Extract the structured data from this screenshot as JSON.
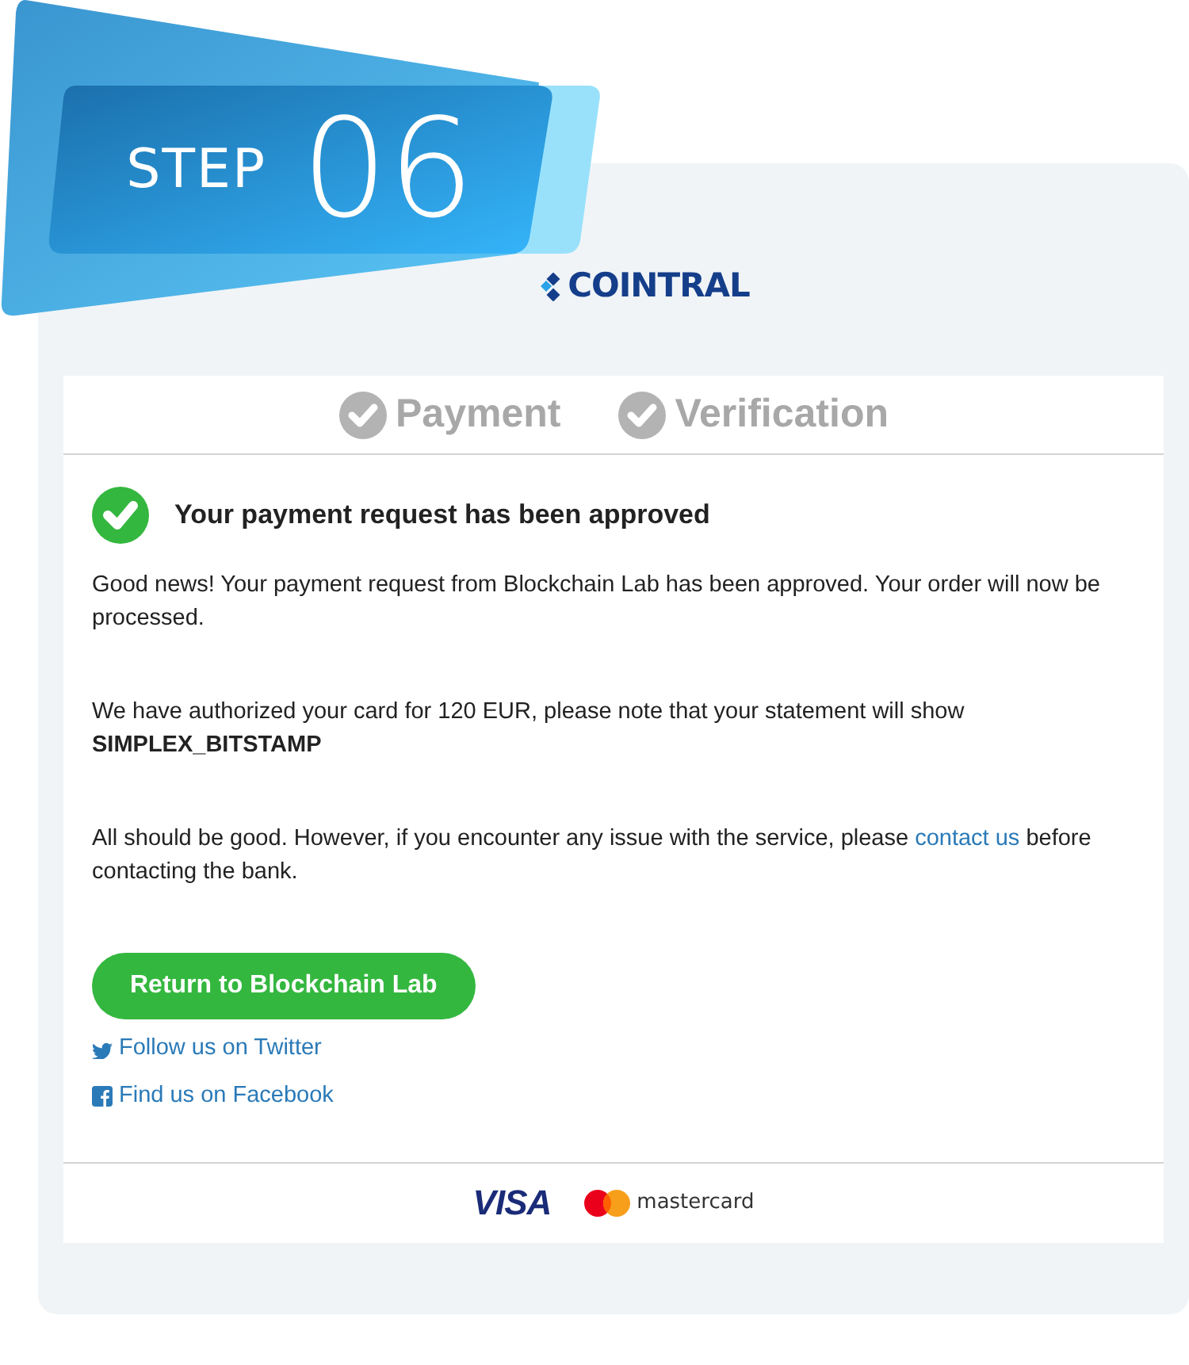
{
  "banner": {
    "label": "STEP",
    "number": "06"
  },
  "logo": {
    "text": "COINTRAL"
  },
  "steps": [
    {
      "label": "Payment"
    },
    {
      "label": "Verification"
    }
  ],
  "message": {
    "title": "Your payment request has been approved",
    "paragraphs": [
      "Good news! Your payment request from Blockchain Lab has been approved. Your order will now be processed.",
      "We have authorized your card for 120 EUR, please note that your statement will show **SIMPLEX_BITSTAMP**"
    ],
    "contact": {
      "before": "All should be good. However, if you encounter any issue with the service, please",
      "link": "contact us",
      "after": "before contacting the bank."
    }
  },
  "return_button": "Return to Blockchain Lab",
  "social_links": [
    {
      "kind": "twitter",
      "label": "Follow us on Twitter"
    },
    {
      "kind": "facebook",
      "label": "Find us on Facebook"
    }
  ],
  "card_brands": [
    "VISA",
    "mastercard"
  ]
}
